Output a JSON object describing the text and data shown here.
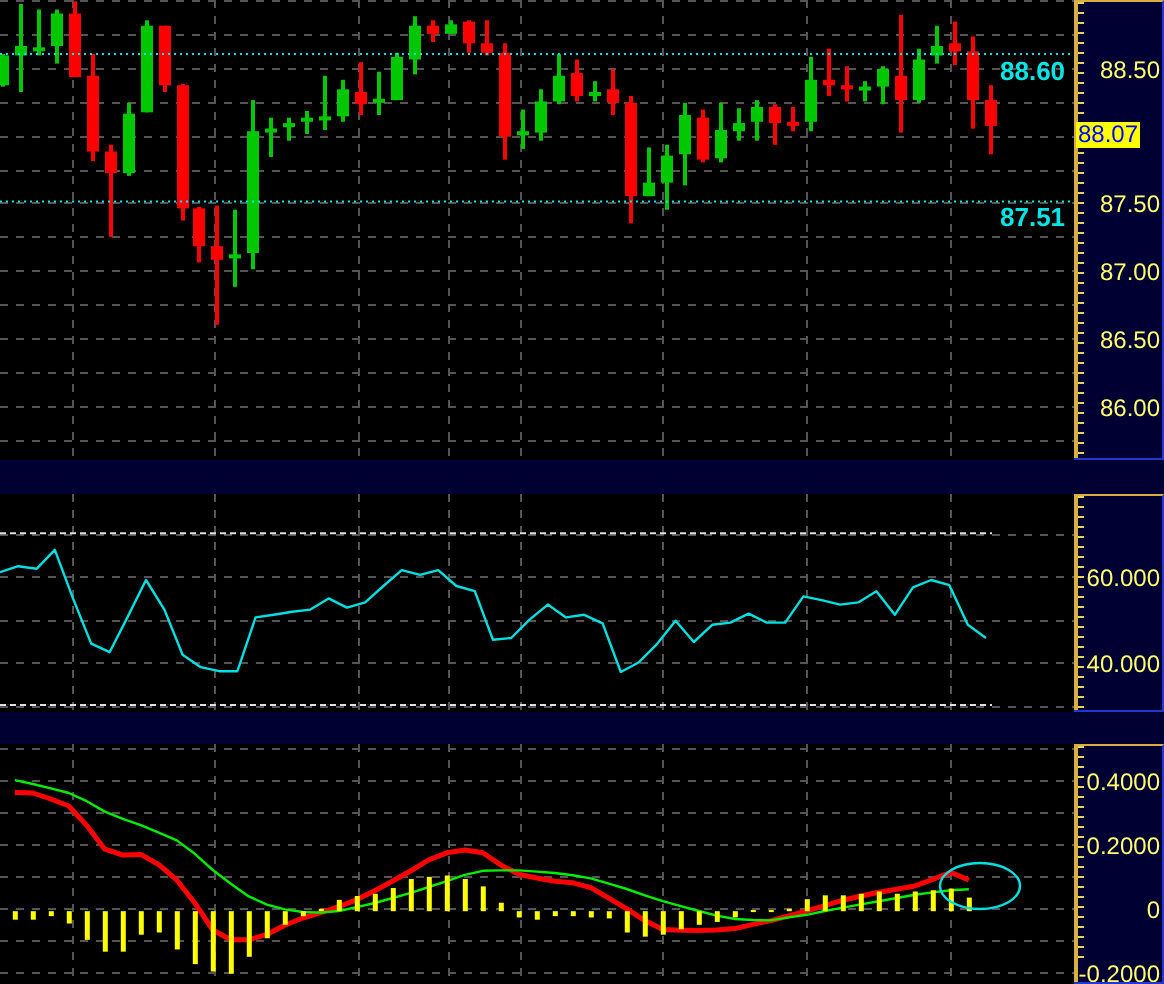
{
  "price_panel": {
    "chart_data": {
      "type": "candlestick",
      "ylim": [
        85.6,
        89.0
      ],
      "grid": true,
      "yticks": [
        {
          "value": 86,
          "label": "86.00"
        },
        {
          "value": 86.5,
          "label": "86.50"
        },
        {
          "value": 87,
          "label": "87.00"
        },
        {
          "value": 87.5,
          "label": "87.50"
        },
        {
          "value": 88.5,
          "label": "88.50"
        }
      ],
      "ohlc": [
        [
          88.37,
          88.6,
          88.36,
          88.59
        ],
        [
          88.59,
          88.97,
          88.32,
          88.66
        ],
        [
          88.63,
          88.93,
          88.59,
          88.65
        ],
        [
          88.66,
          88.93,
          88.53,
          88.9
        ],
        [
          88.9,
          88.99,
          88.43,
          88.43
        ],
        [
          88.44,
          88.6,
          87.81,
          87.88
        ],
        [
          87.88,
          87.93,
          87.25,
          87.72
        ],
        [
          87.72,
          88.24,
          87.7,
          88.16
        ],
        [
          88.17,
          88.85,
          88.17,
          88.81
        ],
        [
          88.81,
          88.81,
          88.32,
          88.37
        ],
        [
          88.37,
          88.38,
          87.37,
          87.46
        ],
        [
          87.46,
          87.47,
          87.06,
          87.18
        ],
        [
          87.18,
          87.48,
          86.6,
          87.08
        ],
        [
          87.09,
          87.45,
          86.88,
          87.12
        ],
        [
          87.13,
          88.26,
          87.01,
          88.03
        ],
        [
          88.03,
          88.13,
          87.84,
          88.05
        ],
        [
          88.06,
          88.13,
          87.96,
          88.09
        ],
        [
          88.1,
          88.18,
          88.01,
          88.13
        ],
        [
          88.11,
          88.44,
          88.04,
          88.14
        ],
        [
          88.14,
          88.41,
          88.1,
          88.34
        ],
        [
          88.32,
          88.54,
          88.15,
          88.23
        ],
        [
          88.24,
          88.47,
          88.15,
          88.27
        ],
        [
          88.26,
          88.61,
          88.26,
          88.58
        ],
        [
          88.56,
          88.88,
          88.45,
          88.81
        ],
        [
          88.81,
          88.85,
          88.69,
          88.75
        ],
        [
          88.75,
          88.85,
          88.75,
          88.82
        ],
        [
          88.84,
          88.85,
          88.61,
          88.68
        ],
        [
          88.68,
          88.85,
          88.59,
          88.61
        ],
        [
          88.61,
          88.68,
          87.82,
          87.99
        ],
        [
          88.0,
          88.19,
          87.9,
          88.03
        ],
        [
          88.02,
          88.34,
          87.96,
          88.25
        ],
        [
          88.25,
          88.6,
          88.23,
          88.44
        ],
        [
          88.46,
          88.56,
          88.25,
          88.29
        ],
        [
          88.29,
          88.4,
          88.25,
          88.32
        ],
        [
          88.34,
          88.49,
          88.15,
          88.24
        ],
        [
          88.24,
          88.29,
          87.35,
          87.55
        ],
        [
          87.55,
          87.91,
          87.55,
          87.65
        ],
        [
          87.65,
          87.93,
          87.45,
          87.85
        ],
        [
          87.86,
          88.24,
          87.63,
          88.15
        ],
        [
          88.13,
          88.19,
          87.8,
          87.82
        ],
        [
          87.83,
          88.24,
          87.8,
          88.04
        ],
        [
          88.03,
          88.2,
          87.96,
          88.09
        ],
        [
          88.1,
          88.26,
          87.96,
          88.21
        ],
        [
          88.21,
          88.23,
          87.93,
          88.09
        ],
        [
          88.1,
          88.21,
          88.03,
          88.07
        ],
        [
          88.1,
          88.58,
          88.03,
          88.41
        ],
        [
          88.41,
          88.64,
          88.29,
          88.37
        ],
        [
          88.37,
          88.51,
          88.25,
          88.34
        ],
        [
          88.34,
          88.4,
          88.25,
          88.36
        ],
        [
          88.36,
          88.51,
          88.23,
          88.49
        ],
        [
          88.44,
          88.89,
          88.02,
          88.26
        ],
        [
          88.26,
          88.64,
          88.24,
          88.56
        ],
        [
          88.59,
          88.81,
          88.53,
          88.66
        ],
        [
          88.68,
          88.84,
          88.52,
          88.62
        ],
        [
          88.62,
          88.73,
          88.05,
          88.26
        ],
        [
          88.26,
          88.37,
          87.86,
          88.07
        ]
      ],
      "ref_lines": [
        {
          "axis": "y",
          "value": 88.6,
          "label": "88.60"
        },
        {
          "axis": "y",
          "value": 87.51,
          "label": "87.51"
        }
      ],
      "annotations": [
        "88.07"
      ]
    }
  },
  "rsi_panel": {
    "chart_data": {
      "type": "line",
      "ylim": [
        28.4,
        79.1
      ],
      "grid": true,
      "yticks": [
        {
          "value": 40,
          "label": "40.000"
        },
        {
          "value": 60,
          "label": "60.000"
        }
      ],
      "series": [
        {
          "color": "#00e0e0",
          "values": [
            60.9,
            62.3,
            61.7,
            66.1,
            54.8,
            44.3,
            42.3,
            50.6,
            59.1,
            52.2,
            41.7,
            38.8,
            37.9,
            37.9,
            50.4,
            51.0,
            51.7,
            52.2,
            54.8,
            52.7,
            53.9,
            57.7,
            61.4,
            60.3,
            61.4,
            57.7,
            56.5,
            45.2,
            45.6,
            49.9,
            53.4,
            50.4,
            51.0,
            49.0,
            37.7,
            40.0,
            44.3,
            49.6,
            44.7,
            48.7,
            49.2,
            51.3,
            49.2,
            49.2,
            55.3,
            54.4,
            53.4,
            53.9,
            56.5,
            51.0,
            57.4,
            59.1,
            57.9,
            48.7,
            45.6
          ]
        }
      ],
      "ref_lines": [
        {
          "axis": "y",
          "value": 70
        },
        {
          "axis": "y",
          "value": 30
        }
      ]
    }
  },
  "macd_panel": {
    "chart_data": {
      "type": "line",
      "ylim": [
        -0.24,
        0.51
      ],
      "grid": true,
      "yticks": [
        {
          "value": -0.2,
          "label": "-0.2000"
        },
        {
          "value": 0,
          "label": "0"
        },
        {
          "value": 0.2,
          "label": "0.2000"
        },
        {
          "value": 0.4,
          "label": "0.4000"
        }
      ],
      "series": [
        {
          "color": "#ff0000",
          "values": [
            0.359,
            0.357,
            0.338,
            0.316,
            0.255,
            0.181,
            0.163,
            0.165,
            0.133,
            0.085,
            0.013,
            -0.071,
            -0.102,
            -0.102,
            -0.085,
            -0.056,
            -0.034,
            -0.017,
            0.002,
            0.024,
            0.051,
            0.082,
            0.114,
            0.148,
            0.17,
            0.179,
            0.17,
            0.132,
            0.103,
            0.091,
            0.081,
            0.076,
            0.061,
            0.028,
            -0.005,
            -0.042,
            -0.07,
            -0.072,
            -0.073,
            -0.071,
            -0.067,
            -0.054,
            -0.042,
            -0.027,
            -0.012,
            0.005,
            0.022,
            0.035,
            0.047,
            0.056,
            0.066,
            0.087,
            0.109,
            0.085
          ]
        },
        {
          "color": "#00ee00",
          "values": [
            0.397,
            0.385,
            0.371,
            0.357,
            0.331,
            0.299,
            0.276,
            0.256,
            0.233,
            0.209,
            0.167,
            0.116,
            0.073,
            0.034,
            0.008,
            -0.007,
            -0.015,
            -0.017,
            -0.012,
            0.0,
            0.013,
            0.029,
            0.045,
            0.063,
            0.081,
            0.101,
            0.114,
            0.115,
            0.115,
            0.111,
            0.107,
            0.1,
            0.09,
            0.074,
            0.057,
            0.037,
            0.019,
            0.003,
            -0.012,
            -0.026,
            -0.037,
            -0.04,
            -0.041,
            -0.032,
            -0.024,
            -0.012,
            -0.001,
            0.009,
            0.019,
            0.029,
            0.039,
            0.046,
            0.053,
            0.056
          ]
        },
        {
          "color": "#ffff00",
          "type": "bar",
          "values": [
            -0.039,
            -0.039,
            -0.028,
            -0.051,
            -0.102,
            -0.139,
            -0.139,
            -0.086,
            -0.079,
            -0.132,
            -0.178,
            -0.201,
            -0.208,
            -0.155,
            -0.097,
            -0.055,
            -0.028,
            -0.005,
            0.023,
            0.035,
            0.042,
            0.06,
            0.088,
            0.095,
            0.099,
            0.088,
            0.065,
            0.014,
            -0.032,
            -0.039,
            -0.028,
            -0.028,
            -0.032,
            -0.035,
            -0.079,
            -0.092,
            -0.086,
            -0.069,
            -0.055,
            -0.046,
            -0.032,
            -0.009,
            -0.009,
            -0.005,
            0.025,
            0.037,
            0.037,
            0.042,
            0.049,
            0.042,
            0.049,
            0.053,
            0.058,
            0.03
          ]
        }
      ]
    }
  }
}
